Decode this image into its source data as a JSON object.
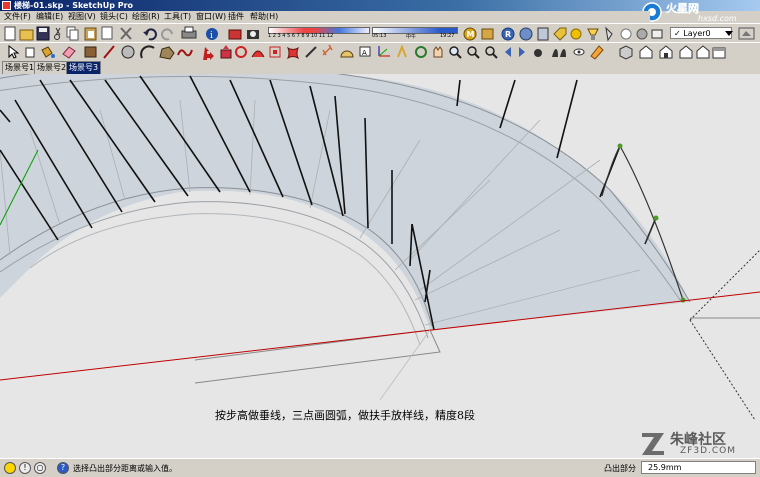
{
  "window": {
    "title": "楼梯-01.skp - SketchUp Pro"
  },
  "menu": [
    "文件(F)",
    "编辑(E)",
    "视图(V)",
    "镜头(C)",
    "绘图(R)",
    "工具(T)",
    "窗口(W)",
    "插件",
    "帮助(H)"
  ],
  "shadow_bar": {
    "months": "1 2 3 4 5 6 7 8 9 10 11 12",
    "time": "05:13",
    "noon": "中午",
    "end": "19:27"
  },
  "layer": {
    "selected": "Layer0",
    "check": "✓"
  },
  "scene_tabs": [
    "场景号1",
    "场景号2",
    "场景号3"
  ],
  "active_tab": 2,
  "caption": "按步高做垂线，三点画圆弧，做扶手放样线，精度8段",
  "status": {
    "hint": "选择凸出部分距离或输入值。",
    "measure_label": "凸出部分",
    "measure_value": "25.9mm"
  },
  "watermark_bottom": {
    "name": "朱峰社区",
    "url": "ZF3D.COM"
  },
  "watermark_top": {
    "name": "火星网",
    "url": "hxsd.com"
  },
  "colors": {
    "title_bar": "#0a246a",
    "viewport": "#e6e6e6",
    "axis_red": "#c00000",
    "axis_green": "#00a000",
    "fill": "#cdd4db"
  }
}
